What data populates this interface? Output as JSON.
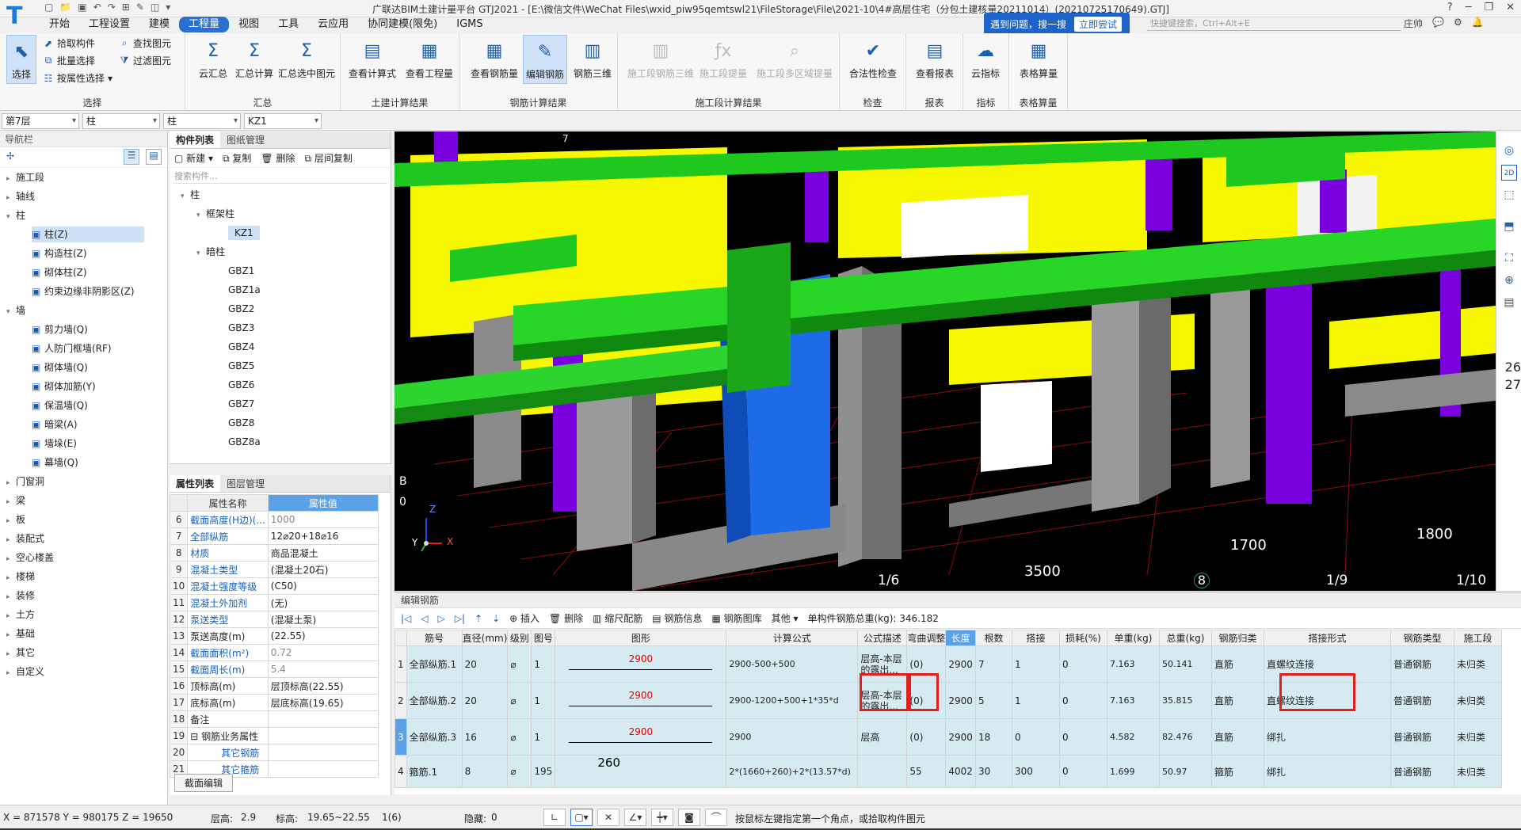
{
  "window": {
    "title": "广联达BIM土建计量平台 GTJ2021 - [E:\\微信文件\\WeChat Files\\wxid_piw95qemtswl21\\FileStorage\\File\\2021-10\\4#高层住宅（分包土建核量20211014）(20210725170649).GTJ]",
    "logo": "T",
    "controls": [
      "?",
      "─",
      "❐",
      "✕"
    ]
  },
  "menu": {
    "tabs": [
      "开始",
      "工程设置",
      "建模",
      "工程量",
      "视图",
      "工具",
      "云应用",
      "协同建模(限免)",
      "IGMS"
    ],
    "active_index": 3
  },
  "help": {
    "text": "遇到问题，搜一搜",
    "button": "立即尝试",
    "shortcut_placeholder": "快捷键搜索，Ctrl+Alt+E",
    "user": "庄帅"
  },
  "ribbon": {
    "select_group": {
      "label": "选择",
      "select": "选择",
      "pick": "拾取构件",
      "batch": "批量选择",
      "by_attr": "按属性选择",
      "find": "查找图元",
      "filter": "过滤图元"
    },
    "sum_group": {
      "label": "汇总",
      "cloud": "云汇总",
      "calc": "汇总计算",
      "selected": "汇总选中图元"
    },
    "civil_group": {
      "label": "土建计算结果",
      "formula": "查看计算式",
      "quantity": "查看工程量"
    },
    "rebar_group": {
      "label": "钢筋计算结果",
      "view_qty": "查看钢筋量",
      "edit": "编辑钢筋",
      "three_d": "钢筋三维"
    },
    "stage_group": {
      "label": "施工段计算结果",
      "stage_3d": "施工段钢筋三维",
      "stage_extract": "施工段提量",
      "stage_multi": "施工段多区域提量"
    },
    "check_group": {
      "label": "检查",
      "legality": "合法性检查"
    },
    "report_group": {
      "label": "报表",
      "view": "查看报表"
    },
    "index_group": {
      "label": "指标",
      "cloud": "云指标"
    },
    "table_group": {
      "label": "表格算量",
      "calc": "表格算量"
    }
  },
  "filters": {
    "floor": "第7层",
    "type": "柱",
    "subtype": "柱",
    "component": "KZ1"
  },
  "nav": {
    "title": "导航栏",
    "items": [
      {
        "label": "施工段",
        "level": 0,
        "expanded": false
      },
      {
        "label": "轴线",
        "level": 0,
        "expanded": false
      },
      {
        "label": "柱",
        "level": 0,
        "expanded": true
      },
      {
        "label": "柱(Z)",
        "level": 1,
        "selected": true
      },
      {
        "label": "构造柱(Z)",
        "level": 1
      },
      {
        "label": "砌体柱(Z)",
        "level": 1
      },
      {
        "label": "约束边缘非阴影区(Z)",
        "level": 1
      },
      {
        "label": "墙",
        "level": 0,
        "expanded": true
      },
      {
        "label": "剪力墙(Q)",
        "level": 1
      },
      {
        "label": "人防门框墙(RF)",
        "level": 1
      },
      {
        "label": "砌体墙(Q)",
        "level": 1
      },
      {
        "label": "砌体加筋(Y)",
        "level": 1
      },
      {
        "label": "保温墙(Q)",
        "level": 1
      },
      {
        "label": "暗梁(A)",
        "level": 1
      },
      {
        "label": "墙垛(E)",
        "level": 1
      },
      {
        "label": "幕墙(Q)",
        "level": 1
      },
      {
        "label": "门窗洞",
        "level": 0,
        "expanded": false
      },
      {
        "label": "梁",
        "level": 0,
        "expanded": false
      },
      {
        "label": "板",
        "level": 0,
        "expanded": false
      },
      {
        "label": "装配式",
        "level": 0,
        "expanded": false
      },
      {
        "label": "空心楼盖",
        "level": 0,
        "expanded": false
      },
      {
        "label": "楼梯",
        "level": 0,
        "expanded": false
      },
      {
        "label": "装修",
        "level": 0,
        "expanded": false
      },
      {
        "label": "土方",
        "level": 0,
        "expanded": false
      },
      {
        "label": "基础",
        "level": 0,
        "expanded": false
      },
      {
        "label": "其它",
        "level": 0,
        "expanded": false
      },
      {
        "label": "自定义",
        "level": 0,
        "expanded": false
      }
    ]
  },
  "components": {
    "tabs": [
      "构件列表",
      "图纸管理"
    ],
    "tools": [
      "新建",
      "复制",
      "删除",
      "层间复制"
    ],
    "search_placeholder": "搜索构件...",
    "tree": [
      {
        "label": "柱",
        "level": 0
      },
      {
        "label": "框架柱",
        "level": 1
      },
      {
        "label": "KZ1",
        "level": 2,
        "selected": true
      },
      {
        "label": "暗柱",
        "level": 1
      },
      {
        "label": "GBZ1",
        "level": 2
      },
      {
        "label": "GBZ1a",
        "level": 2
      },
      {
        "label": "GBZ2",
        "level": 2
      },
      {
        "label": "GBZ3",
        "level": 2
      },
      {
        "label": "GBZ4",
        "level": 2
      },
      {
        "label": "GBZ5",
        "level": 2
      },
      {
        "label": "GBZ6",
        "level": 2
      },
      {
        "label": "GBZ7",
        "level": 2
      },
      {
        "label": "GBZ8",
        "level": 2
      },
      {
        "label": "GBZ8a",
        "level": 2
      }
    ]
  },
  "properties": {
    "tabs": [
      "属性列表",
      "图层管理"
    ],
    "header_name": "属性名称",
    "header_value": "属性值",
    "rows": [
      {
        "n": "6",
        "name": "截面高度(H边)(...",
        "value": "1000",
        "blue": true,
        "grey": true
      },
      {
        "n": "7",
        "name": "全部纵筋",
        "value": "12⌀20+18⌀16",
        "blue": true
      },
      {
        "n": "8",
        "name": "材质",
        "value": "商品混凝土",
        "blue": true
      },
      {
        "n": "9",
        "name": "混凝土类型",
        "value": "(混凝土20石)",
        "blue": true
      },
      {
        "n": "10",
        "name": "混凝土强度等级",
        "value": "(C50)",
        "blue": true
      },
      {
        "n": "11",
        "name": "混凝土外加剂",
        "value": "(无)",
        "blue": true
      },
      {
        "n": "12",
        "name": "泵送类型",
        "value": "(混凝土泵)",
        "blue": true
      },
      {
        "n": "13",
        "name": "泵送高度(m)",
        "value": "(22.55)",
        "blue": false
      },
      {
        "n": "14",
        "name": "截面面积(m²)",
        "value": "0.72",
        "blue": true,
        "grey": true
      },
      {
        "n": "15",
        "name": "截面周长(m)",
        "value": "5.4",
        "blue": true,
        "grey": true
      },
      {
        "n": "16",
        "name": "顶标高(m)",
        "value": "层顶标高(22.55)",
        "blue": false
      },
      {
        "n": "17",
        "name": "底标高(m)",
        "value": "层底标高(19.65)",
        "blue": false
      },
      {
        "n": "18",
        "name": "备注",
        "value": "",
        "blue": false
      },
      {
        "n": "19",
        "name": "⊟ 钢筋业务属性",
        "value": "",
        "blue": false
      },
      {
        "n": "20",
        "name": "其它钢筋",
        "value": "",
        "blue": true,
        "indent": true
      },
      {
        "n": "21",
        "name": "其它箍筋",
        "value": "",
        "blue": true,
        "indent": true
      }
    ],
    "section_edit": "截面编辑"
  },
  "viewport": {
    "dims": [
      "1700",
      "1800",
      "3500"
    ],
    "axis_labels": [
      "1/6",
      "8",
      "1/9",
      "1/10",
      "7"
    ],
    "left_labels": [
      "B",
      "0"
    ],
    "axis_x": "X",
    "axis_y": "Y",
    "axis_z": "Z"
  },
  "viewtools": {
    "icons": [
      "globe-icon",
      "2d-icon",
      "cube-icon",
      "box-icon",
      "fullscreen-icon",
      "target-icon",
      "note-icon"
    ],
    "floor_labels": [
      "26",
      "27"
    ]
  },
  "rebar": {
    "title": "编辑钢筋",
    "tools": [
      "插入",
      "删除",
      "缩尺配筋",
      "钢筋信息",
      "钢筋图库",
      "其他"
    ],
    "total": "单构件钢筋总重(kg): 346.182",
    "columns": [
      "筋号",
      "直径(mm)",
      "级别",
      "图号",
      "图形",
      "计算公式",
      "公式描述",
      "弯曲调整",
      "长度",
      "根数",
      "搭接",
      "损耗(%)",
      "单重(kg)",
      "总重(kg)",
      "钢筋归类",
      "搭接形式",
      "钢筋类型",
      "施工段"
    ],
    "rows": [
      {
        "rn": "1",
        "no": "全部纵筋.1",
        "d": "20",
        "grade": "⌀",
        "fig": "1",
        "shape": "2900",
        "formula": "2900-500+500",
        "desc": "层高-本层的露出...",
        "bend": "(0)",
        "len": "2900",
        "count": "7",
        "lap": "1",
        "loss": "0",
        "unit": "7.163",
        "total": "50.141",
        "cat": "直筋",
        "lapform": "直螺纹连接",
        "type": "普通钢筋",
        "stage": "未归类"
      },
      {
        "rn": "2",
        "no": "全部纵筋.2",
        "d": "20",
        "grade": "⌀",
        "fig": "1",
        "shape": "2900",
        "formula": "2900-1200+500+1*35*d",
        "desc": "层高-本层的露出...",
        "bend": "(0)",
        "len": "2900",
        "count": "5",
        "lap": "1",
        "loss": "0",
        "unit": "7.163",
        "total": "35.815",
        "cat": "直筋",
        "lapform": "直螺纹连接",
        "type": "普通钢筋",
        "stage": "未归类"
      },
      {
        "rn": "3",
        "no": "全部纵筋.3",
        "d": "16",
        "grade": "⌀",
        "fig": "1",
        "shape": "2900",
        "formula": "2900",
        "desc": "层高",
        "bend": "(0)",
        "len": "2900",
        "count": "18",
        "lap": "0",
        "loss": "0",
        "unit": "4.582",
        "total": "82.476",
        "cat": "直筋",
        "lapform": "绑扎",
        "type": "普通钢筋",
        "stage": "未归类"
      },
      {
        "rn": "4",
        "no": "箍筋.1",
        "d": "8",
        "grade": "⌀",
        "fig": "195",
        "shape": "260",
        "formula": "2*(1660+260)+2*(13.57*d)",
        "desc": "",
        "bend": "55",
        "len": "4002",
        "count": "30",
        "lap": "300",
        "loss": "0",
        "unit": "1.699",
        "total": "50.97",
        "cat": "箍筋",
        "lapform": "绑扎",
        "type": "普通钢筋",
        "stage": "未归类"
      }
    ]
  },
  "status": {
    "coords": "X = 871578 Y = 980175 Z = 19650",
    "floor_height_label": "层高:",
    "floor_height": "2.9",
    "elev_label": "标高:",
    "elev": "19.65~22.55",
    "count": "1(6)",
    "hidden_label": "隐藏:",
    "hidden": "0",
    "hint": "按鼠标左键指定第一个角点，或拾取构件图元"
  }
}
